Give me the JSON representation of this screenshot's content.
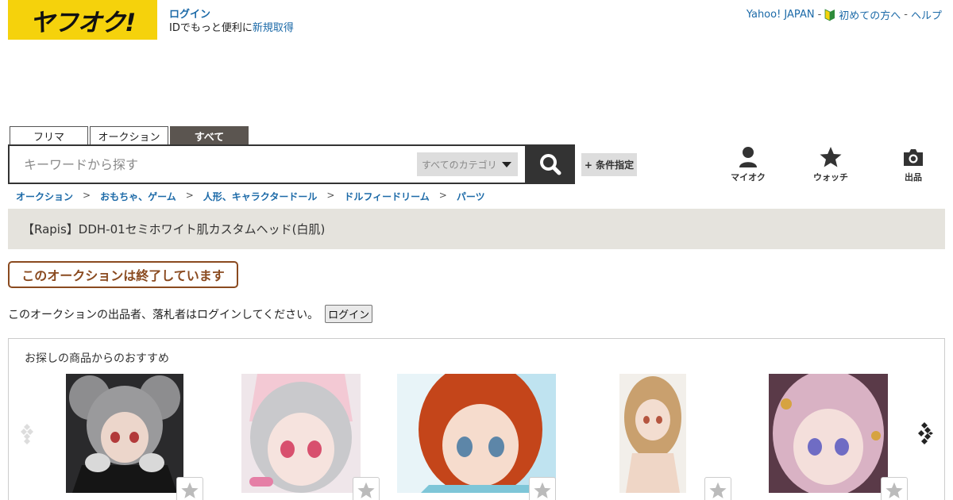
{
  "header": {
    "logo_text": "ヤフオク!",
    "login_label": "ログイン",
    "login_sub_text": "IDでもっと便利に",
    "signup_label": "新規取得",
    "yahoo_japan": "Yahoo! JAPAN",
    "first_time": "初めての方へ",
    "help": "ヘルプ",
    "separator": "-"
  },
  "tabs": [
    {
      "label": "フリマ",
      "active": false
    },
    {
      "label": "オークション",
      "active": false
    },
    {
      "label": "すべて",
      "active": true
    }
  ],
  "search": {
    "placeholder": "キーワードから探す",
    "category_label": "すべてのカテゴリ",
    "condition_label": "+ 条件指定"
  },
  "quick_links": [
    {
      "label": "マイオク",
      "icon": "person-icon"
    },
    {
      "label": "ウォッチ",
      "icon": "star-icon"
    },
    {
      "label": "出品",
      "icon": "camera-icon"
    }
  ],
  "breadcrumb": [
    "オークション",
    "おもちゃ、ゲーム",
    "人形、キャラクタードール",
    "ドルフィードリーム",
    "パーツ"
  ],
  "breadcrumb_separator": ">",
  "item_title": "【Rapis】DDH-01セミホワイト肌カスタムヘッド(白肌)",
  "ended_label": "このオークションは終了しています",
  "notice": {
    "text": "このオークションの出品者、落札者はログインしてください。",
    "button": "ログイン"
  },
  "recommend": {
    "title": "お探しの商品からのおすすめ",
    "items": [
      {
        "image": "doll-gray-cat-ears"
      },
      {
        "image": "doll-silver-hair-pink-bow"
      },
      {
        "image": "doll-red-hair"
      },
      {
        "image": "doll-blonde-hair"
      },
      {
        "image": "doll-pink-hair"
      }
    ]
  },
  "colors": {
    "logo_bg": "#f5d20c",
    "link": "#1c6aa8",
    "ended_border": "#8a4a1f",
    "title_bar_bg": "#e5e3dd"
  }
}
